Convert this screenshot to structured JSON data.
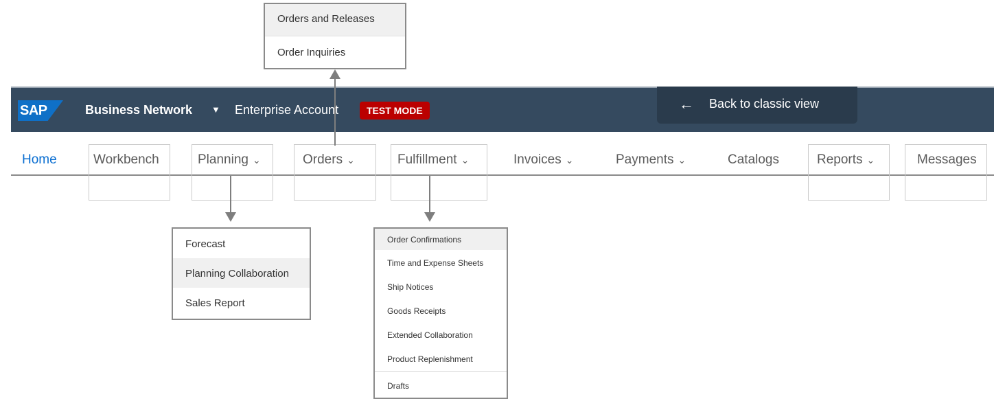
{
  "header": {
    "logo_text": "SAP",
    "network_title": "Business Network",
    "network_caret": "▼",
    "account_name": "Enterprise Account",
    "test_badge": "TEST MODE",
    "back_arrow": "←",
    "back_label": "Back to classic view",
    "colors": {
      "bar": "#354a5f",
      "badge": "#bb0000",
      "logo": "#0f70c7",
      "link": "#0a6ed1"
    }
  },
  "nav": {
    "home": "Home",
    "workbench": "Workbench",
    "planning": "Planning",
    "orders": "Orders",
    "fulfillment": "Fulfillment",
    "invoices": "Invoices",
    "payments": "Payments",
    "catalogs": "Catalogs",
    "reports": "Reports",
    "messages": "Messages",
    "chevron": "⌄"
  },
  "orders_menu": {
    "items": [
      "Orders and Releases",
      "Order Inquiries"
    ]
  },
  "planning_menu": {
    "items": [
      "Forecast",
      "Planning Collaboration",
      "Sales Report"
    ]
  },
  "fulfillment_menu": {
    "items": [
      "Order Confirmations",
      "Time and Expense Sheets",
      "Ship Notices",
      "Goods Receipts",
      "Extended Collaboration",
      "Product Replenishment",
      "Drafts"
    ]
  }
}
